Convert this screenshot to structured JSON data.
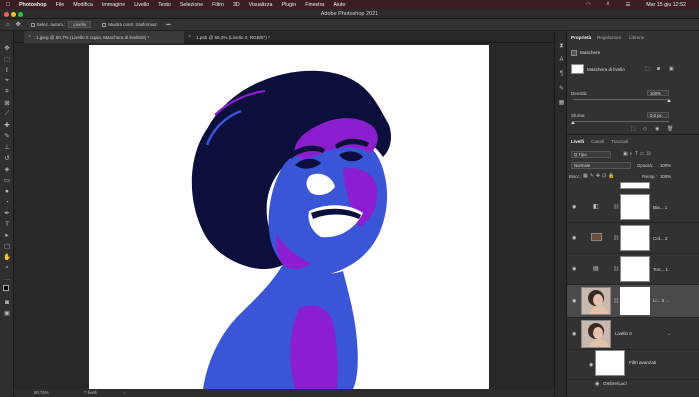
{
  "menubar": {
    "app_name": "Photoshop",
    "items": [
      "File",
      "Modifica",
      "Immagine",
      "Livello",
      "Testo",
      "Selezione",
      "Filtro",
      "3D",
      "Visualizza",
      "Plugin",
      "Finestra",
      "Aiuto"
    ],
    "clock": "Mar 15 giu 12:52"
  },
  "window": {
    "title": "Adobe Photoshop 2021"
  },
  "options": {
    "autoselect_label": "Selez. autom.:",
    "autoselect_value": "Livello",
    "transform_label": "Mostra contr. trasformaz.",
    "more": "•••"
  },
  "tabs": [
    {
      "label": "1.jpeg @ 80,7% (Livello 0 copia, Maschera di livello/8) *"
    },
    {
      "label": "1.psb @ 55,3% (Livello 0, RGB/8*) *"
    }
  ],
  "statusbar": {
    "zoom": "80,74%",
    "info": "7 livelli"
  },
  "properties": {
    "tabs": [
      "Proprietà",
      "Regolazioni",
      "Librerie"
    ],
    "section_label": "Maschere",
    "mask_label": "Maschera di livello",
    "density_label": "Densità:",
    "density_value": "100%",
    "feather_label": "Sfuma:",
    "feather_value": "0,0 px",
    "density_level": 1.0,
    "feather_level": 0.0
  },
  "layers_panel": {
    "tabs": [
      "Livelli",
      "Canali",
      "Tracciati"
    ],
    "filter_label": "Q Tipo",
    "blend_mode": "Normale",
    "opacity_label": "Opacità:",
    "opacity_value": "100%",
    "lock_label": "Blocc.:",
    "fill_label": "Riemp.:",
    "fill_value": "100%",
    "layers": [
      {
        "name": "Bia... 1"
      },
      {
        "name": "Col... 2"
      },
      {
        "name": "Ton... 1"
      },
      {
        "name": "Li... 0 ..."
      },
      {
        "name": "Livello 0"
      },
      {
        "name": "Filtri avanzati"
      },
      {
        "name": "Ombre/Luci"
      }
    ]
  },
  "colors": {
    "accent_blue": "#3a55d6",
    "accent_purple": "#8b1fd0",
    "navy": "#0c0f3c",
    "menubar_bg": "#3b1e22",
    "panel_bg": "#323232"
  }
}
